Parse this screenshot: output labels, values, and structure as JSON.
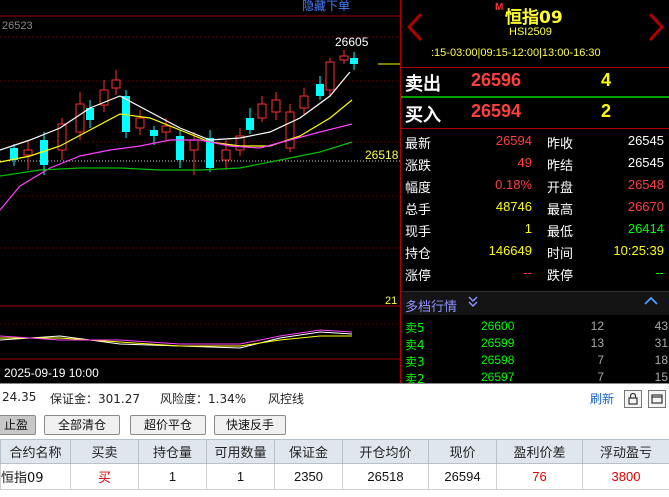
{
  "chart": {
    "hide_orders_label": "隐藏下单",
    "price_top_label": "26523",
    "high_mark_label": "26605",
    "avg_price_label": "26518",
    "indicator_label": "21",
    "date_label": "2025-09-19 10:00",
    "colors": {
      "up": "#ff3030",
      "down": "#00ffff",
      "ma_white": "#ffffff",
      "ma_yellow": "#ffff00",
      "ma_magenta": "#ff40ff",
      "ma_green": "#00c000"
    }
  },
  "header": {
    "market_flag": "M",
    "name": "恒指09",
    "code": "HSI2509",
    "hours": ":15-03:00|09:15-12:00|13:00-16:30"
  },
  "orderbook": {
    "ask_label": "卖出",
    "ask_price": "26596",
    "ask_vol": "4",
    "bid_label": "买入",
    "bid_price": "26594",
    "bid_vol": "2"
  },
  "stats": [
    {
      "l1": "最新",
      "v1": "26594",
      "c1": "#ff3e3e",
      "l2": "昨收",
      "v2": "26545",
      "c2": "#ffffff"
    },
    {
      "l1": "涨跌",
      "v1": "49",
      "c1": "#ff3e3e",
      "l2": "昨结",
      "v2": "26545",
      "c2": "#ffffff"
    },
    {
      "l1": "幅度",
      "v1": "0.18%",
      "c1": "#ff3e3e",
      "l2": "开盘",
      "v2": "26548",
      "c2": "#ff3e3e"
    },
    {
      "l1": "总手",
      "v1": "48746",
      "c1": "#ffff00",
      "l2": "最高",
      "v2": "26670",
      "c2": "#ff3e3e"
    },
    {
      "l1": "现手",
      "v1": "1",
      "c1": "#ffff00",
      "l2": "最低",
      "v2": "26414",
      "c2": "#00ff00"
    },
    {
      "l1": "持仓",
      "v1": "146649",
      "c1": "#ffff00",
      "l2": "时间",
      "v2": "10:25:39",
      "c2": "#ffff00"
    },
    {
      "l1": "涨停",
      "v1": "--",
      "c1": "#ff3e3e",
      "l2": "跌停",
      "v2": "--",
      "c2": "#00ff00"
    }
  ],
  "depth": {
    "title": "多档行情",
    "chevron": "»",
    "rows": [
      {
        "label": "卖5",
        "price": "26600",
        "vol": "12",
        "vol2": "43"
      },
      {
        "label": "卖4",
        "price": "26599",
        "vol": "13",
        "vol2": "31"
      },
      {
        "label": "卖3",
        "price": "26598",
        "vol": "7",
        "vol2": "18"
      },
      {
        "label": "卖2",
        "price": "26597",
        "vol": "7",
        "vol2": "15"
      }
    ]
  },
  "account": {
    "available": "24.35",
    "margin": "保证金：301.27",
    "risk": "风险度：1.34%",
    "risk_line": "风控线",
    "refresh": "刷新"
  },
  "buttons": {
    "close_tab": "止盈",
    "close_all": "全部清仓",
    "close_profit": "超价平仓",
    "reverse": "快速反手"
  },
  "table": {
    "headers": [
      "合约名称",
      "买卖",
      "持仓量",
      "可用数量",
      "保证金",
      "开仓均价",
      "现价",
      "盈利价差",
      "浮动盈亏"
    ],
    "rows": [
      [
        "恒指09",
        "买",
        "1",
        "1",
        "2350",
        "26518",
        "26594",
        "76",
        "3800"
      ]
    ]
  }
}
